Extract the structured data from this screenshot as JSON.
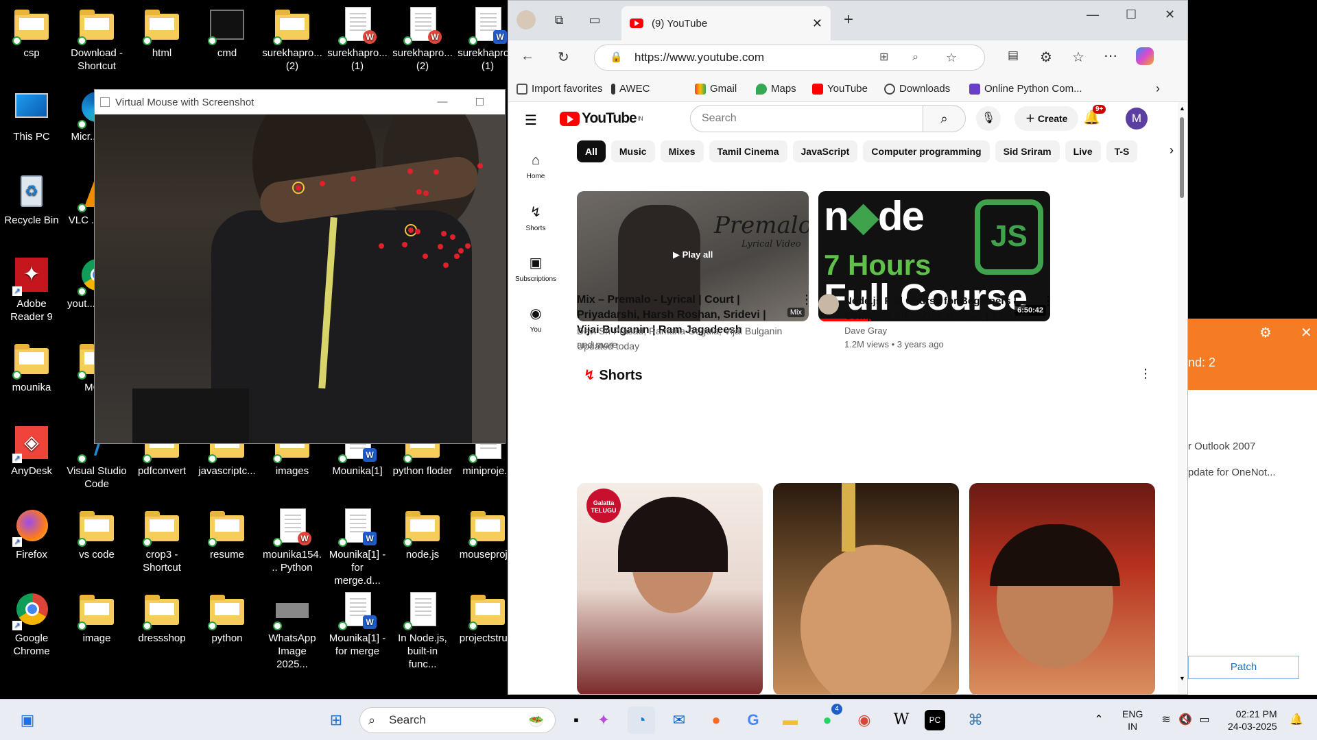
{
  "desktop": {
    "icons": [
      {
        "label": "csp",
        "kind": "folder",
        "col": 0,
        "row": 0
      },
      {
        "label": "Download - Shortcut",
        "kind": "folder",
        "col": 1,
        "row": 0
      },
      {
        "label": "html",
        "kind": "folder",
        "col": 2,
        "row": 0
      },
      {
        "label": "cmd",
        "kind": "cmd",
        "col": 3,
        "row": 0
      },
      {
        "label": "surekhapro... (2)",
        "kind": "folder",
        "col": 4,
        "row": 0
      },
      {
        "label": "surekhapro... (1)",
        "kind": "wps",
        "col": 5,
        "row": 0
      },
      {
        "label": "surekhapro... (2)",
        "kind": "wps",
        "col": 6,
        "row": 0
      },
      {
        "label": "surekhapro... (1)",
        "kind": "word",
        "col": 7,
        "row": 0
      },
      {
        "label": "This PC",
        "kind": "pc",
        "col": 0,
        "row": 1
      },
      {
        "label": "Micr... Ed...",
        "kind": "edge",
        "col": 1,
        "row": 1
      },
      {
        "label": "Recycle Bin",
        "kind": "bin",
        "col": 0,
        "row": 2
      },
      {
        "label": "VLC ... pla...",
        "kind": "vlc",
        "col": 1,
        "row": 2
      },
      {
        "label": "Adobe Reader 9",
        "kind": "adobe",
        "col": 0,
        "row": 3
      },
      {
        "label": "yout... Goo...",
        "kind": "chrome",
        "col": 1,
        "row": 3
      },
      {
        "label": "mounika",
        "kind": "folder",
        "col": 0,
        "row": 4
      },
      {
        "label": "MC...",
        "kind": "folder",
        "col": 1,
        "row": 4
      },
      {
        "label": "AnyDesk",
        "kind": "anydesk",
        "col": 0,
        "row": 5
      },
      {
        "label": "Visual Studio Code",
        "kind": "vscode",
        "col": 1,
        "row": 5
      },
      {
        "label": "pdfconvert",
        "kind": "folder",
        "col": 2,
        "row": 5
      },
      {
        "label": "javascriptc...",
        "kind": "folder",
        "col": 3,
        "row": 5
      },
      {
        "label": "images",
        "kind": "folder",
        "col": 4,
        "row": 5
      },
      {
        "label": "Mounika[1]",
        "kind": "word",
        "col": 5,
        "row": 5
      },
      {
        "label": "python floder",
        "kind": "folder",
        "col": 6,
        "row": 5
      },
      {
        "label": "miniproje...",
        "kind": "doc",
        "col": 7,
        "row": 5
      },
      {
        "label": "Firefox",
        "kind": "firefox",
        "col": 0,
        "row": 6
      },
      {
        "label": "vs code",
        "kind": "folder",
        "col": 1,
        "row": 6
      },
      {
        "label": "crop3 - Shortcut",
        "kind": "folder",
        "col": 2,
        "row": 6
      },
      {
        "label": "resume",
        "kind": "folder",
        "col": 3,
        "row": 6
      },
      {
        "label": "mounika154... Python",
        "kind": "wps",
        "col": 4,
        "row": 6
      },
      {
        "label": "Mounika[1] - for merge.d...",
        "kind": "word",
        "col": 5,
        "row": 6
      },
      {
        "label": "node.js",
        "kind": "folder",
        "col": 6,
        "row": 6
      },
      {
        "label": "mouseproj...",
        "kind": "folder",
        "col": 7,
        "row": 6
      },
      {
        "label": "Google Chrome",
        "kind": "chrome",
        "col": 0,
        "row": 7
      },
      {
        "label": "image",
        "kind": "folder",
        "col": 1,
        "row": 7
      },
      {
        "label": "dressshop",
        "kind": "folder",
        "col": 2,
        "row": 7
      },
      {
        "label": "python",
        "kind": "folder",
        "col": 3,
        "row": 7
      },
      {
        "label": "WhatsApp Image 2025...",
        "kind": "image",
        "col": 4,
        "row": 7
      },
      {
        "label": "Mounika[1] - for merge",
        "kind": "word",
        "col": 5,
        "row": 7
      },
      {
        "label": "In Node.js, built-in func...",
        "kind": "doc",
        "col": 6,
        "row": 7
      },
      {
        "label": "projectstru...",
        "kind": "folder",
        "col": 7,
        "row": 7
      }
    ]
  },
  "vm_window": {
    "title": "Virtual Mouse with Screenshot"
  },
  "browser": {
    "tab_title": "(9) YouTube",
    "url": "https://www.youtube.com",
    "favorites": [
      "Import favorites",
      "AWEC",
      "Gmail",
      "Maps",
      "YouTube",
      "Downloads",
      "Online Python Com..."
    ]
  },
  "youtube": {
    "logo": "YouTube",
    "region": "IN",
    "search_placeholder": "Search",
    "create": "Create",
    "notif_count": "9+",
    "avatar": "M",
    "sidebar": [
      "Home",
      "Shorts",
      "Subscriptions",
      "You"
    ],
    "chips": [
      "All",
      "Music",
      "Mixes",
      "Tamil Cinema",
      "JavaScript",
      "Computer programming",
      "Sid Sriram",
      "Live",
      "T-S"
    ],
    "video1": {
      "title": "Mix – Premalo - Lyrical | Court | Priyadarshi, Harsh Roshan, Sridevi | Vijai Bulganin | Ram Jagadeesh",
      "meta1": "Devi Sri Prasad, Ramana Gogula, Vijai Bulganin and more",
      "meta2": "Updated today",
      "overlay": "Play all",
      "badge": "Mix",
      "thumb_title": "Premalo",
      "thumb_sub": "Lyrical Video"
    },
    "video2": {
      "title": "Node.js Full Course for Beginners | Complete All-in-One Tutorial | 7 Hours",
      "channel": "Dave Gray",
      "meta": "1.2M views • 3 years ago",
      "duration": "6:50:42",
      "thumb_line1": "7 Hours",
      "thumb_line2": "Full Course",
      "thumb_js": "JS"
    },
    "shorts_title": "Shorts",
    "short_badge": "Galatta TELUGU"
  },
  "side_panel": {
    "text1": "nd: 2",
    "text2": "r Outlook 2007",
    "text3": "pdate for OneNot...",
    "button": "Patch"
  },
  "taskbar": {
    "search": "Search",
    "lang1": "ENG",
    "lang2": "IN",
    "time": "02:21 PM",
    "date": "24-03-2025",
    "whatsapp_badge": "4"
  }
}
